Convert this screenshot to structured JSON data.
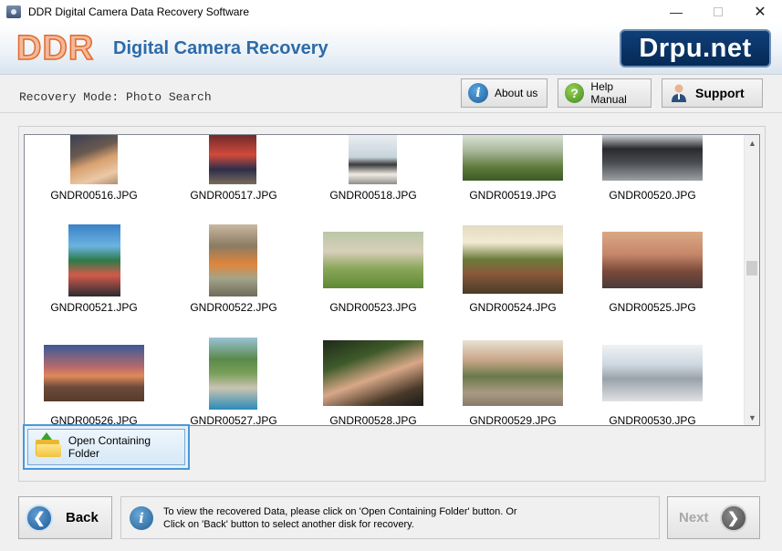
{
  "window": {
    "title": "DDR Digital Camera Data Recovery Software"
  },
  "header": {
    "logo": "DDR",
    "product": "Digital Camera Recovery",
    "brand": "Drpu.net"
  },
  "toolbar": {
    "mode_label": "Recovery Mode: Photo Search",
    "about": "About us",
    "help": "Help Manual",
    "support": "Support"
  },
  "gallery": {
    "files": [
      "GNDR00516.JPG",
      "GNDR00517.JPG",
      "GNDR00518.JPG",
      "GNDR00519.JPG",
      "GNDR00520.JPG",
      "GNDR00521.JPG",
      "GNDR00522.JPG",
      "GNDR00523.JPG",
      "GNDR00524.JPG",
      "GNDR00525.JPG",
      "GNDR00526.JPG",
      "GNDR00527.JPG",
      "GNDR00528.JPG",
      "GNDR00529.JPG",
      "GNDR00530.JPG"
    ]
  },
  "actions": {
    "open_folder": "Open Containing Folder"
  },
  "footer": {
    "back": "Back",
    "next": "Next",
    "info_line1": "To view the recovered Data, please click on 'Open Containing Folder' button. Or",
    "info_line2": "Click on 'Back' button to select another disk for recovery."
  },
  "colors": {
    "accent": "#2d6ba8",
    "brand_bg": "#052a57",
    "logo": "#e06a2c",
    "selection": "#4a98d8"
  },
  "icons": [
    "app-icon",
    "minimize-icon",
    "maximize-icon",
    "close-icon",
    "info-icon",
    "help-icon",
    "support-person-icon",
    "folder-icon",
    "back-arrow-icon",
    "next-arrow-icon"
  ]
}
